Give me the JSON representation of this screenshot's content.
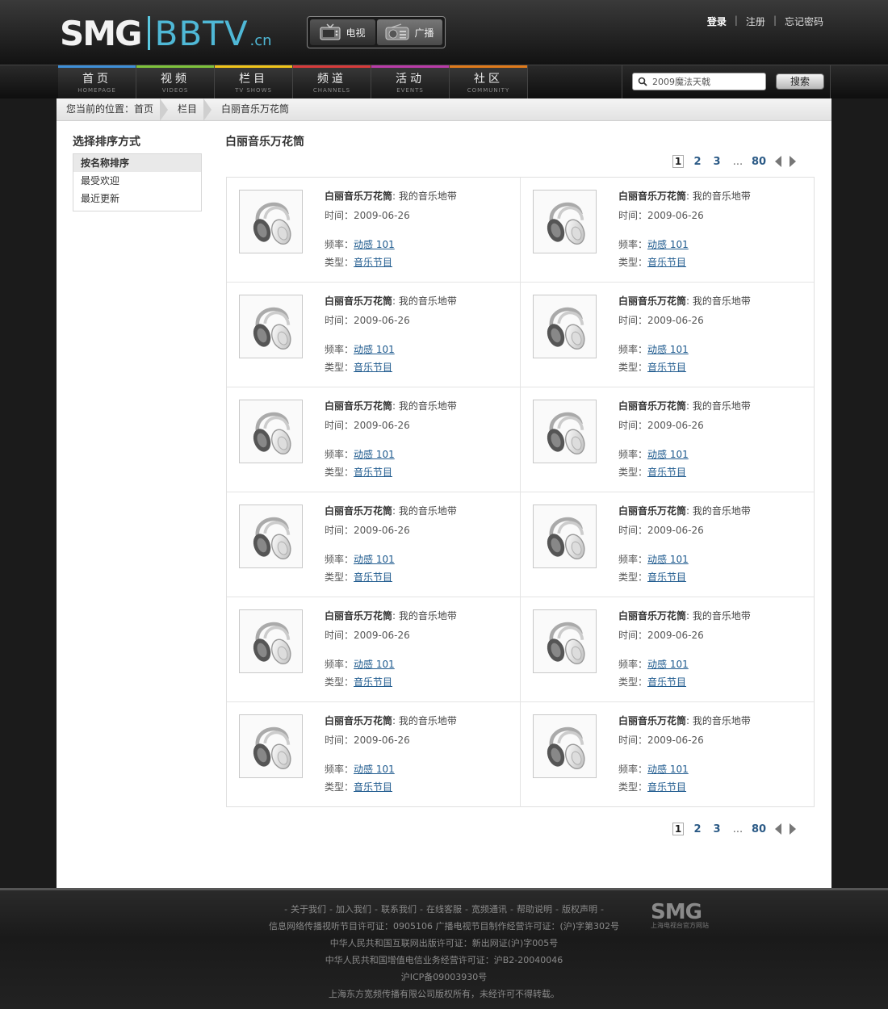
{
  "header": {
    "logo_main": "SMG",
    "logo_brand": "BBTV",
    "logo_tld": ".cn",
    "media_tabs": [
      {
        "label": "电视",
        "icon": "tv-icon"
      },
      {
        "label": "广播",
        "icon": "radio-icon"
      }
    ],
    "user_links": {
      "login": "登录",
      "sep1": "|",
      "register": "注册",
      "sep2": "|",
      "forgot": "忘记密码"
    }
  },
  "nav": {
    "items": [
      {
        "label": "首页",
        "sub": "HOMEPAGE",
        "color": "#3e8fd8"
      },
      {
        "label": "视频",
        "sub": "VIDEOS",
        "color": "#7ec23a"
      },
      {
        "label": "栏目",
        "sub": "TV SHOWS",
        "color": "#f0c419"
      },
      {
        "label": "频道",
        "sub": "CHANNELS",
        "color": "#d83a3a"
      },
      {
        "label": "活动",
        "sub": "EVENTS",
        "color": "#b93aa8"
      },
      {
        "label": "社区",
        "sub": "COMMUNITY",
        "color": "#e07a1a"
      }
    ],
    "search": {
      "value": "2009魔法天戟",
      "button": "搜索"
    }
  },
  "breadcrumb": {
    "items": [
      "您当前的位置：首页",
      "栏目",
      "白丽音乐万花筒"
    ]
  },
  "sidebar": {
    "title": "选择排序方式",
    "items": [
      {
        "label": "按名称排序",
        "active": true
      },
      {
        "label": "最受欢迎",
        "active": false
      },
      {
        "label": "最近更新",
        "active": false
      }
    ]
  },
  "content": {
    "title": "白丽音乐万花筒",
    "pager": {
      "current": "1",
      "pages": [
        "2",
        "3"
      ],
      "dots": "...",
      "last": "80"
    },
    "item": {
      "title_bold": "白丽音乐万花筒",
      "title_rest": ": 我的音乐地带",
      "time_label": "时间：",
      "time": "2009-06-26",
      "freq_label": "频率：",
      "freq": "动感 101",
      "type_label": "类型：",
      "type": "音乐节目"
    },
    "item_count": 12
  },
  "footer": {
    "links": [
      "关于我们",
      "加入我们",
      "联系我们",
      "在线客服",
      "宽频通讯",
      "帮助说明",
      "版权声明"
    ],
    "dash": "-",
    "lines": [
      "信息网络传播视听节目许可证：0905106 广播电视节目制作经营许可证：(沪)字第302号",
      "中华人民共和国互联网出版许可证：新出网证(沪)字005号",
      "中华人民共和国增值电信业务经营许可证：沪B2-20040046",
      "沪ICP备09003930号",
      "上海东方宽频传播有限公司版权所有，未经许可不得转载。"
    ],
    "logo_text": "SMG",
    "logo_sub": "上海电视台官方网站"
  }
}
